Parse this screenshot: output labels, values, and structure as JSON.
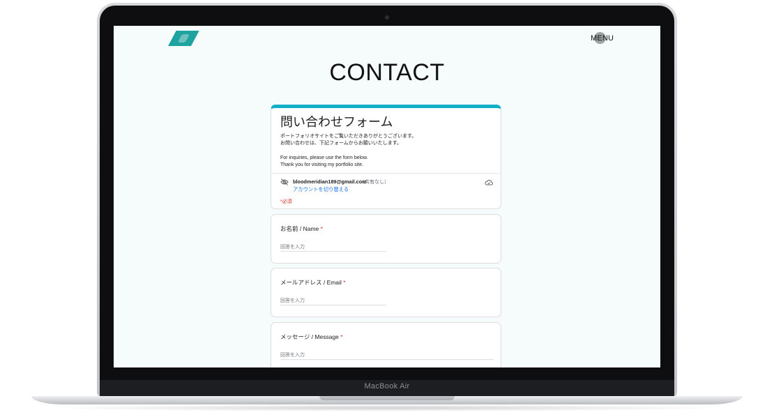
{
  "device": {
    "model_label": "MacBook Air"
  },
  "site": {
    "menu_label": "MENU",
    "page_title": "CONTACT"
  },
  "form": {
    "title": "問い合わせフォーム",
    "description_jp_1": "ポートフォリオサイトをご覧いただきありがとうございます。",
    "description_jp_2": "お問い合わせは、下記フォームからお願いいたします。",
    "description_en_1": "For inquiries, please use the form below.",
    "description_en_2": "Thank you for visiting my portfolio site.",
    "account_email": "bloodmeridian189@gmail.com",
    "shared_status": "（共有なし）",
    "switch_account": "アカウントを切り替える",
    "required_note": "*必須",
    "accent_color": "#12b0c8",
    "questions": [
      {
        "label": "お名前 / Name",
        "required_mark": "*",
        "placeholder": "回答を入力"
      },
      {
        "label": "メールアドレス / Email",
        "required_mark": "*",
        "placeholder": "回答を入力"
      },
      {
        "label": "メッセージ / Message",
        "required_mark": "*",
        "placeholder": "回答を入力"
      }
    ]
  }
}
